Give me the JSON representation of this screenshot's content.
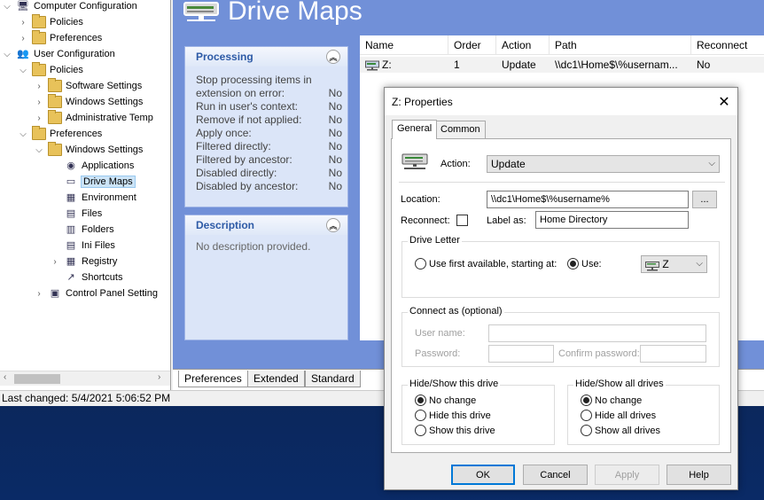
{
  "tree": {
    "items": [
      {
        "label": "Computer Configuration",
        "expander": "⌵",
        "icon": "computer-icon",
        "depth": 0
      },
      {
        "label": "Policies",
        "expander": "›",
        "icon": "folder-icon",
        "depth": 1
      },
      {
        "label": "Preferences",
        "expander": "›",
        "icon": "folder-icon",
        "depth": 1
      },
      {
        "label": "User Configuration",
        "expander": "⌵",
        "icon": "users-icon",
        "depth": 0
      },
      {
        "label": "Policies",
        "expander": "⌵",
        "icon": "folder-icon",
        "depth": 1
      },
      {
        "label": "Software Settings",
        "expander": "›",
        "icon": "folder-icon",
        "depth": 2
      },
      {
        "label": "Windows Settings",
        "expander": "›",
        "icon": "folder-icon",
        "depth": 2
      },
      {
        "label": "Administrative Temp",
        "expander": "›",
        "icon": "folder-icon",
        "depth": 2
      },
      {
        "label": "Preferences",
        "expander": "⌵",
        "icon": "folder-icon",
        "depth": 1
      },
      {
        "label": "Windows Settings",
        "expander": "⌵",
        "icon": "folder-icon",
        "depth": 2
      },
      {
        "label": "Applications",
        "expander": "",
        "icon": "applications-icon",
        "depth": 3
      },
      {
        "label": "Drive Maps",
        "expander": "",
        "icon": "drive-icon",
        "depth": 3,
        "selected": true
      },
      {
        "label": "Environment",
        "expander": "",
        "icon": "environment-icon",
        "depth": 3
      },
      {
        "label": "Files",
        "expander": "",
        "icon": "files-icon",
        "depth": 3
      },
      {
        "label": "Folders",
        "expander": "",
        "icon": "folders-icon",
        "depth": 3
      },
      {
        "label": "Ini Files",
        "expander": "",
        "icon": "ini-files-icon",
        "depth": 3
      },
      {
        "label": "Registry",
        "expander": "›",
        "icon": "registry-icon",
        "depth": 3
      },
      {
        "label": "Shortcuts",
        "expander": "",
        "icon": "shortcuts-icon",
        "depth": 3
      },
      {
        "label": "Control Panel Setting",
        "expander": "›",
        "icon": "control-panel-icon",
        "depth": 2
      }
    ]
  },
  "status": {
    "text": "Last changed: 5/4/2021 5:06:52 PM"
  },
  "main": {
    "title": "Drive Maps",
    "processing": {
      "heading": "Processing",
      "rows": [
        {
          "label": "Stop processing items in",
          "value": ""
        },
        {
          "label": "extension on error:",
          "value": "No"
        },
        {
          "label": "Run in user's context:",
          "value": "No"
        },
        {
          "label": "Remove if not applied:",
          "value": "No"
        },
        {
          "label": "Apply once:",
          "value": "No"
        },
        {
          "label": "Filtered directly:",
          "value": "No"
        },
        {
          "label": "Filtered by ancestor:",
          "value": "No"
        },
        {
          "label": "Disabled directly:",
          "value": "No"
        },
        {
          "label": "Disabled by ancestor:",
          "value": "No"
        }
      ]
    },
    "description": {
      "heading": "Description",
      "text": "No description provided."
    },
    "list": {
      "columns": [
        "Name",
        "Order",
        "Action",
        "Path",
        "Reconnect"
      ],
      "row": {
        "name": "Z:",
        "order": "1",
        "action": "Update",
        "path": "\\\\dc1\\Home$\\%usernam...",
        "reconnect": "No"
      }
    },
    "tabs": [
      "Preferences",
      "Extended",
      "Standard"
    ]
  },
  "dialog": {
    "title": "Z: Properties",
    "close": "✕",
    "tabs": [
      "General",
      "Common"
    ],
    "action_label": "Action:",
    "action_value": "Update",
    "location_label": "Location:",
    "location_value": "\\\\dc1\\Home$\\%username%",
    "browse_label": "...",
    "reconnect_label": "Reconnect:",
    "label_as_label": "Label as:",
    "label_as_value": "Home Directory",
    "drive_letter_group": "Drive Letter",
    "use_first_label": "Use first available, starting at:",
    "use_label": "Use:",
    "drive_value": "Z",
    "connect_as_group": "Connect as (optional)",
    "user_name_label": "User name:",
    "password_label": "Password:",
    "confirm_password_label": "Confirm password:",
    "hide_show_drive_group": "Hide/Show this drive",
    "hide_show_drive_options": [
      "No change",
      "Hide this drive",
      "Show this drive"
    ],
    "hide_show_all_group": "Hide/Show all drives",
    "hide_show_all_options": [
      "No change",
      "Hide all drives",
      "Show all drives"
    ],
    "buttons": {
      "ok": "OK",
      "cancel": "Cancel",
      "apply": "Apply",
      "help": "Help"
    }
  },
  "colors": {
    "panel_blue": "#7190d8",
    "accent": "#0078d7",
    "heading_blue": "#2d5aa6"
  }
}
